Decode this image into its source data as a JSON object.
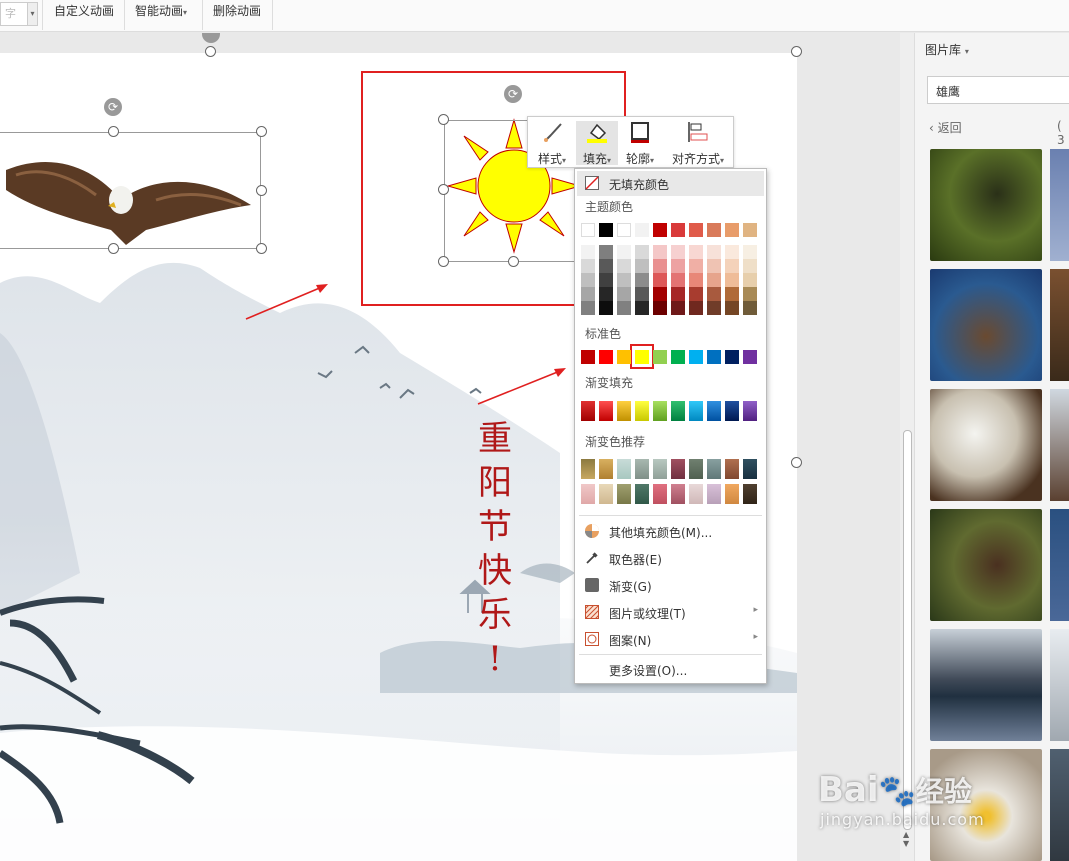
{
  "toolbar": {
    "combo_text": "字",
    "custom_animation": "自定义动画",
    "smart_animation": "智能动画",
    "smart_animation_arrow": "▾",
    "delete_animation": "删除动画"
  },
  "slide": {
    "greeting_chars": [
      "重",
      "阳",
      "节",
      "快",
      "乐",
      "!"
    ]
  },
  "context_toolbar": {
    "style_label": "样式",
    "fill_label": "填充",
    "outline_label": "轮廓",
    "align_label": "对齐方式",
    "dropdown_arrow": "▾"
  },
  "fill_menu": {
    "no_fill": "无填充颜色",
    "theme_colors_title": "主题颜色",
    "standard_colors_title": "标准色",
    "gradient_fill_title": "渐变填充",
    "gradient_recommend_title": "渐变色推荐",
    "theme_top_row": [
      "#ffffff",
      "#000000",
      "#ffffff",
      "#f2f2f2",
      "#c00000",
      "#d93a3a",
      "#e05b4a",
      "#d97a5a",
      "#e89c6a",
      "#e0b482"
    ],
    "theme_columns": [
      [
        "#f2f2f2",
        "#d9d9d9",
        "#bfbfbf",
        "#a6a6a6",
        "#808080"
      ],
      [
        "#7f7f7f",
        "#595959",
        "#404040",
        "#262626",
        "#0d0d0d"
      ],
      [
        "#f2f2f2",
        "#d9d9d9",
        "#bfbfbf",
        "#a6a6a6",
        "#808080"
      ],
      [
        "#d9d9d9",
        "#bfbfbf",
        "#8c8c8c",
        "#595959",
        "#262626"
      ],
      [
        "#f4c7c7",
        "#e99090",
        "#dd5858",
        "#a20000",
        "#6c0000"
      ],
      [
        "#f6d0d0",
        "#eda2a2",
        "#e37373",
        "#a62626",
        "#6f1919"
      ],
      [
        "#f8d7d2",
        "#f0afa5",
        "#e88778",
        "#a83c2f",
        "#70281f"
      ],
      [
        "#f7e1d9",
        "#efc3b3",
        "#e6a48c",
        "#a85a3e",
        "#703c29"
      ],
      [
        "#fae9dd",
        "#f4d2ba",
        "#efbc98",
        "#b06a38",
        "#754625"
      ],
      [
        "#f7efe3",
        "#efdfc8",
        "#e7cfac",
        "#a88a56",
        "#705c39"
      ]
    ],
    "standard_colors": [
      "#c00000",
      "#ff0000",
      "#ffc000",
      "#ffff00",
      "#92d050",
      "#00b050",
      "#00b0f0",
      "#0070c0",
      "#002060",
      "#7030a0"
    ],
    "gradient_fill": [
      [
        "#e03030",
        "#a00000"
      ],
      [
        "#ff5050",
        "#c00000"
      ],
      [
        "#ffd040",
        "#c09000"
      ],
      [
        "#ffff40",
        "#c8c800"
      ],
      [
        "#a8e060",
        "#60a020"
      ],
      [
        "#30c070",
        "#008040"
      ],
      [
        "#30c8f8",
        "#0088c0"
      ],
      [
        "#3090e0",
        "#0050a0"
      ],
      [
        "#2050a0",
        "#001850"
      ],
      [
        "#9060c8",
        "#502080"
      ]
    ],
    "gradient_recommend": [
      [
        "#8c7a40",
        "#c8a860"
      ],
      [
        "#d8b060",
        "#b08030"
      ],
      [
        "#c8dcd8",
        "#a8c8c0"
      ],
      [
        "#a8b8b0",
        "#809088"
      ],
      [
        "#b8c8c0",
        "#90a098"
      ],
      [
        "#a05060",
        "#703040"
      ],
      [
        "#708070",
        "#506050"
      ],
      [
        "#88a0a0",
        "#607878"
      ],
      [
        "#b07050",
        "#804830"
      ],
      [
        "#305060",
        "#183040"
      ],
      [
        "#f0c8c8",
        "#e0a8a8"
      ],
      [
        "#e8d8b8",
        "#d0b890"
      ],
      [
        "#a0a070",
        "#787848"
      ],
      [
        "#507868",
        "#305848"
      ],
      [
        "#e07080",
        "#c05060"
      ],
      [
        "#d08090",
        "#a05060"
      ],
      [
        "#e8d8d8",
        "#d0b8b8"
      ],
      [
        "#d8c0d8",
        "#b8a0b8"
      ],
      [
        "#f0a860",
        "#d08840"
      ],
      [
        "#504030",
        "#302418"
      ]
    ],
    "more_fill": "其他填充颜色(M)...",
    "eyedropper": "取色器(E)",
    "gradient": "渐变(G)",
    "picture_texture": "图片或纹理(T)",
    "pattern": "图案(N)",
    "more_settings": "更多设置(O)...",
    "submenu_arrow": "▸"
  },
  "right_panel": {
    "title": "图片库",
    "title_arrow": "▾",
    "search_value": "雄鹰",
    "back_label": "返回",
    "count_label": "( 3"
  },
  "watermark": {
    "brand": "Bai",
    "brand2": "经验",
    "url": "jingyan.baidu.com"
  },
  "colors": {
    "accent_red": "#e02020",
    "greeting_red": "#b01818",
    "sun_yellow": "#ffff00",
    "sun_outline": "#c00000"
  }
}
